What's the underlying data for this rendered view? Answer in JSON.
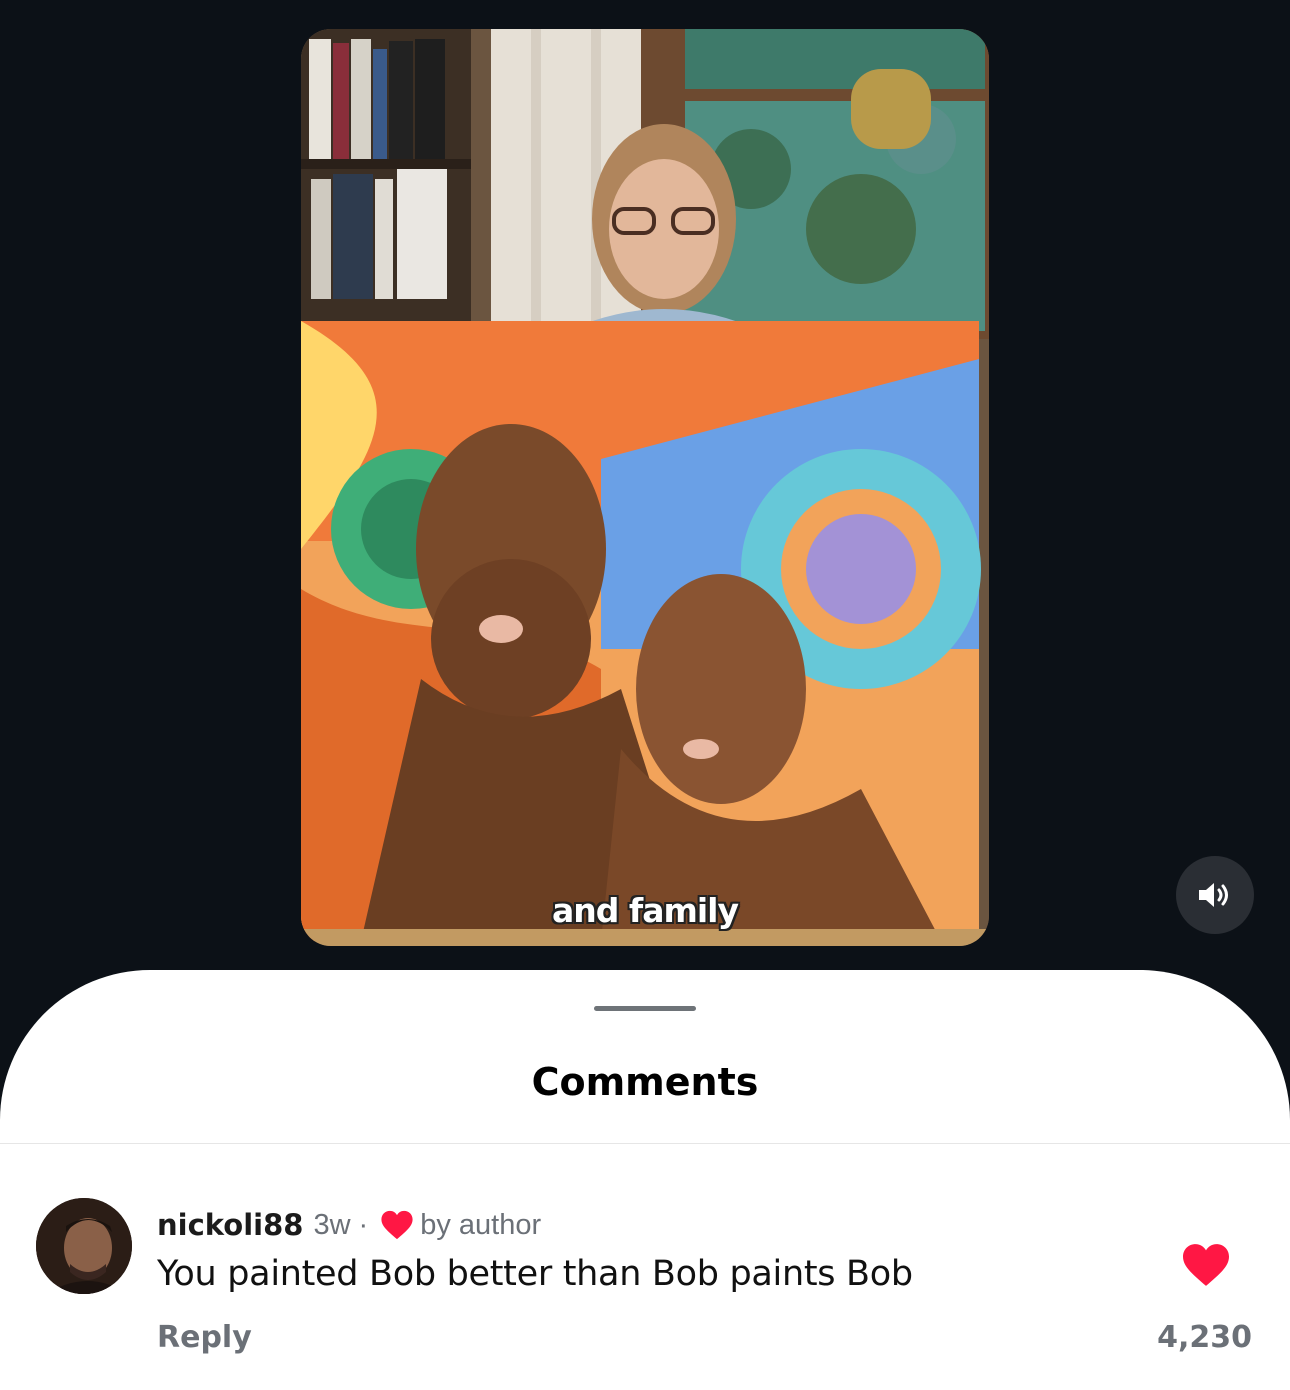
{
  "video": {
    "caption": "and family",
    "mute_icon": "speaker-volume-icon"
  },
  "comments_sheet": {
    "title": "Comments",
    "comments": [
      {
        "username": "nickoli88",
        "time": "3w",
        "separator": "·",
        "liked_by_author_label": "by author",
        "text": "You painted Bob better than Bob paints Bob",
        "reply_label": "Reply",
        "like_count": "4,230",
        "like_color": "#ff1744"
      }
    ]
  }
}
